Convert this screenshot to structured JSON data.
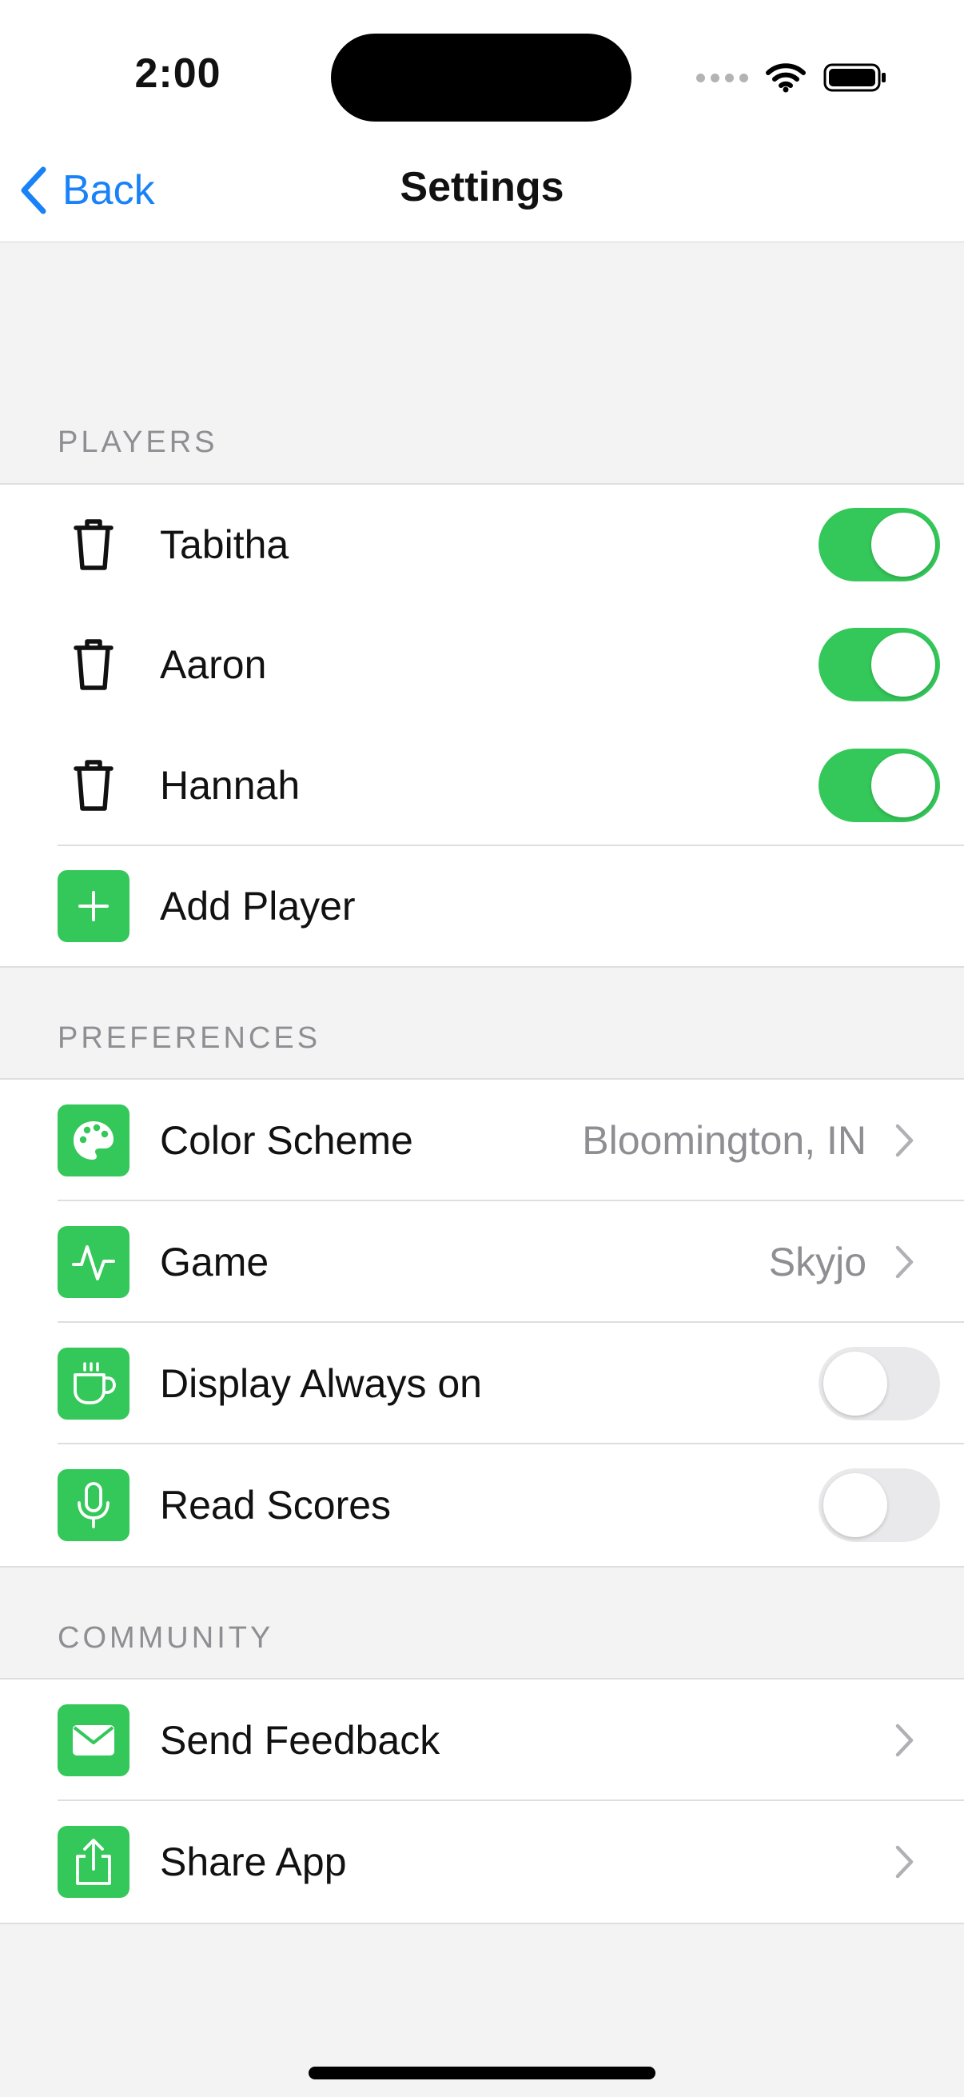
{
  "status": {
    "time": "2:00"
  },
  "nav": {
    "back_label": "Back",
    "title": "Settings"
  },
  "colors": {
    "accent": "#34c759",
    "link": "#1a82f7"
  },
  "players": {
    "header": "PLAYERS",
    "items": [
      {
        "name": "Tabitha",
        "enabled": true
      },
      {
        "name": "Aaron",
        "enabled": true
      },
      {
        "name": "Hannah",
        "enabled": true
      }
    ],
    "add_label": "Add Player"
  },
  "preferences": {
    "header": "PREFERENCES",
    "color_scheme": {
      "label": "Color Scheme",
      "value": "Bloomington, IN",
      "icon": "palette-icon"
    },
    "game": {
      "label": "Game",
      "value": "Skyjo",
      "icon": "waveform-icon"
    },
    "display_always_on": {
      "label": "Display Always on",
      "enabled": false,
      "icon": "cup-icon"
    },
    "read_scores": {
      "label": "Read Scores",
      "enabled": false,
      "icon": "microphone-icon"
    }
  },
  "community": {
    "header": "COMMUNITY",
    "send_feedback": {
      "label": "Send Feedback",
      "icon": "envelope-icon"
    },
    "share_app": {
      "label": "Share App",
      "icon": "share-icon"
    }
  }
}
